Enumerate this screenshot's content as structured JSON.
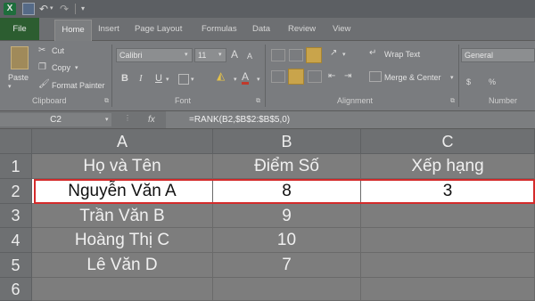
{
  "titlebar": {
    "logo_letter": "X"
  },
  "tabs": [
    "File",
    "Home",
    "Insert",
    "Page Layout",
    "Formulas",
    "Data",
    "Review",
    "View"
  ],
  "clipboard": {
    "paste": "Paste",
    "cut": "Cut",
    "copy": "Copy",
    "format_painter": "Format Painter",
    "label": "Clipboard"
  },
  "font": {
    "name": "Calibri",
    "size": "11",
    "bold": "B",
    "italic": "I",
    "underline": "U",
    "grow": "A",
    "shrink": "A",
    "fill_icon": "paint-bucket-icon",
    "font_color_letter": "A",
    "label": "Font"
  },
  "alignment": {
    "wrap_text": "Wrap Text",
    "merge_center": "Merge & Center",
    "label": "Alignment"
  },
  "number": {
    "format": "General",
    "label": "Number"
  },
  "formula_bar": {
    "cell_ref": "C2",
    "fx": "fx",
    "formula": "=RANK(B2,$B$2:$B$5,0)"
  },
  "sheet": {
    "columns": [
      "A",
      "B",
      "C"
    ],
    "rows": [
      {
        "num": "1",
        "cells": [
          "Họ và Tên",
          "Điểm Số",
          "Xếp hạng"
        ]
      },
      {
        "num": "2",
        "cells": [
          "Nguyễn Văn A",
          "8",
          "3"
        ]
      },
      {
        "num": "3",
        "cells": [
          "Trần Văn B",
          "9",
          ""
        ]
      },
      {
        "num": "4",
        "cells": [
          "Hoàng Thị C",
          "10",
          ""
        ]
      },
      {
        "num": "5",
        "cells": [
          "Lê Văn D",
          "7",
          ""
        ]
      },
      {
        "num": "6",
        "cells": [
          "",
          "",
          ""
        ]
      }
    ]
  },
  "colors": {
    "highlight_border": "#d42a2a",
    "file_tab": "#2c5d30",
    "excel_green": "#1e6e3c"
  }
}
